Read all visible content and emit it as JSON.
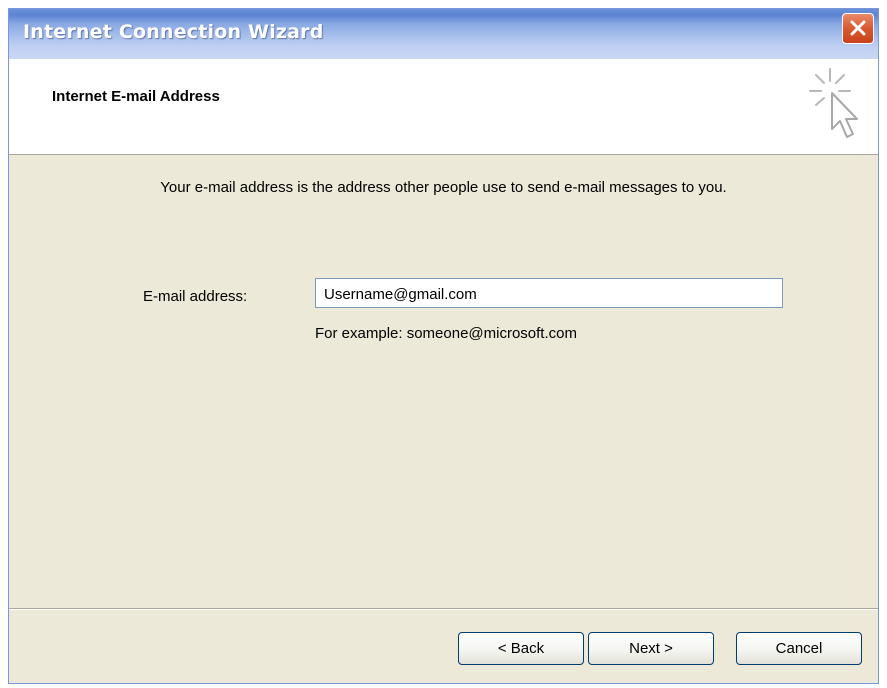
{
  "window": {
    "title": "Internet Connection Wizard"
  },
  "header": {
    "title": "Internet E-mail Address",
    "icon": "wizard-cursor-icon"
  },
  "body": {
    "description": "Your e-mail address is the address other people use to send e-mail messages to you.",
    "email_label": "E-mail address:",
    "email_value": "Username@gmail.com",
    "example": "For example: someone@microsoft.com"
  },
  "footer": {
    "back_label": "< Back",
    "next_label": "Next >",
    "cancel_label": "Cancel"
  },
  "colors": {
    "titlebar": "#8aa9e3",
    "close_button": "#d8582f",
    "dialog_background": "#ece9d8",
    "header_background": "#ffffff"
  }
}
